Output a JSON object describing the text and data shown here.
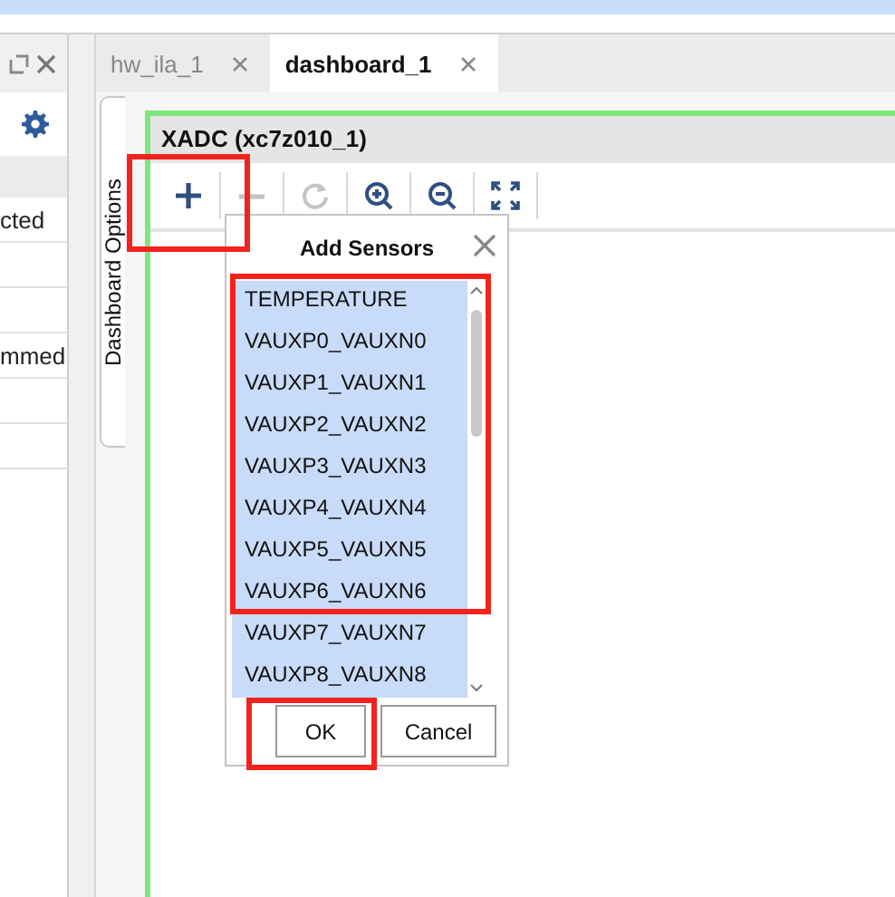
{
  "left_panel": {
    "rows": [
      {
        "text": "cted"
      },
      {
        "text": ""
      },
      {
        "text": ""
      },
      {
        "text": "mmed"
      },
      {
        "text": ""
      },
      {
        "text": ""
      }
    ]
  },
  "tabs": [
    {
      "label": "hw_ila_1",
      "selected": false
    },
    {
      "label": "dashboard_1",
      "selected": true
    }
  ],
  "side_tab": {
    "label": "Dashboard Options"
  },
  "panel": {
    "title": "XADC (xc7z010_1)"
  },
  "toolbar": [
    {
      "kind": "add",
      "disabled": false
    },
    {
      "kind": "remove",
      "disabled": true
    },
    {
      "kind": "refresh",
      "disabled": true
    },
    {
      "kind": "zoom-in",
      "disabled": false
    },
    {
      "kind": "zoom-out",
      "disabled": false
    },
    {
      "kind": "fit",
      "disabled": false
    }
  ],
  "dialog": {
    "title": "Add Sensors",
    "items": [
      {
        "label": "TEMPERATURE",
        "selected": true
      },
      {
        "label": "VAUXP0_VAUXN0",
        "selected": true
      },
      {
        "label": "VAUXP1_VAUXN1",
        "selected": true
      },
      {
        "label": "VAUXP2_VAUXN2",
        "selected": true
      },
      {
        "label": "VAUXP3_VAUXN3",
        "selected": true
      },
      {
        "label": "VAUXP4_VAUXN4",
        "selected": true
      },
      {
        "label": "VAUXP5_VAUXN5",
        "selected": true
      },
      {
        "label": "VAUXP6_VAUXN6",
        "selected": true
      },
      {
        "label": "VAUXP7_VAUXN7",
        "selected": true
      },
      {
        "label": "VAUXP8_VAUXN8",
        "selected": true
      }
    ],
    "buttons": [
      {
        "label": "OK"
      },
      {
        "label": "Cancel"
      }
    ]
  }
}
